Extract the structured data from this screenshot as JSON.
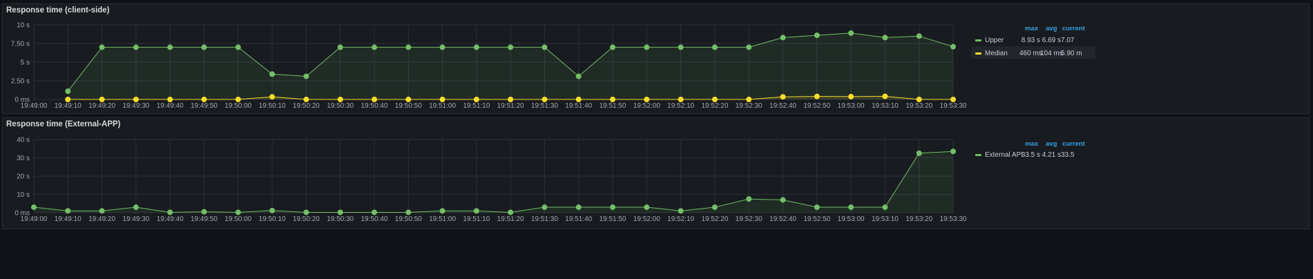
{
  "chart_data": [
    {
      "type": "line",
      "title": "Response time (client-side)",
      "x": [
        "19:49:10",
        "19:49:20",
        "19:49:30",
        "19:49:40",
        "19:49:50",
        "19:50:00",
        "19:50:10",
        "19:50:20",
        "19:50:30",
        "19:50:40",
        "19:50:50",
        "19:51:00",
        "19:51:10",
        "19:51:20",
        "19:51:30",
        "19:51:40",
        "19:51:50",
        "19:52:00",
        "19:52:10",
        "19:52:20",
        "19:52:30",
        "19:52:40",
        "19:52:50",
        "19:53:00",
        "19:53:10",
        "19:53:20",
        "19:53:30"
      ],
      "x_ticks": [
        "19:49:00",
        "19:49:10",
        "19:49:20",
        "19:49:30",
        "19:49:40",
        "19:49:50",
        "19:50:00",
        "19:50:10",
        "19:50:20",
        "19:50:30",
        "19:50:40",
        "19:50:50",
        "19:51:00",
        "19:51:10",
        "19:51:20",
        "19:51:30",
        "19:51:40",
        "19:51:50",
        "19:52:00",
        "19:52:10",
        "19:52:20",
        "19:52:30",
        "19:52:40",
        "19:52:50",
        "19:53:00",
        "19:53:10",
        "19:53:20",
        "19:53:30"
      ],
      "y_ticks": [
        "0 ms",
        "2.50 s",
        "5 s",
        "7.50 s",
        "10 s"
      ],
      "ylim": [
        0,
        10
      ],
      "y_unit": "s",
      "grid": true,
      "legend_position": "right",
      "legend_columns": [
        "max",
        "avg",
        "current"
      ],
      "series": [
        {
          "name": "Upper",
          "color": "#73bf69",
          "values": [
            1.1,
            7.0,
            7.0,
            7.0,
            7.0,
            7.0,
            3.4,
            3.1,
            7.0,
            7.0,
            7.0,
            7.0,
            7.0,
            7.0,
            7.0,
            3.1,
            7.0,
            7.0,
            7.0,
            7.0,
            7.0,
            8.3,
            8.6,
            8.9,
            8.3,
            8.5,
            7.07
          ],
          "stats": [
            "8.93 s",
            "6.69 s",
            "7.07"
          ]
        },
        {
          "name": "Median",
          "color": "#fade2a",
          "values": [
            0.0,
            0.0,
            0.0,
            0.0,
            0.0,
            0.0,
            0.35,
            0.0,
            0.0,
            0.0,
            0.0,
            0.0,
            0.0,
            0.0,
            0.0,
            0.0,
            0.0,
            0.0,
            0.0,
            0.0,
            0.0,
            0.35,
            0.4,
            0.38,
            0.42,
            0.0,
            0.0
          ],
          "stats": [
            "460 ms",
            "104 ms",
            "5.90 m"
          ]
        }
      ]
    },
    {
      "type": "line",
      "title": "Response time (External-APP)",
      "x": [
        "19:49:00",
        "19:49:10",
        "19:49:20",
        "19:49:30",
        "19:49:40",
        "19:49:50",
        "19:50:00",
        "19:50:10",
        "19:50:20",
        "19:50:30",
        "19:50:40",
        "19:50:50",
        "19:51:00",
        "19:51:10",
        "19:51:20",
        "19:51:30",
        "19:51:40",
        "19:51:50",
        "19:52:00",
        "19:52:10",
        "19:52:20",
        "19:52:30",
        "19:52:40",
        "19:52:50",
        "19:53:00",
        "19:53:10",
        "19:53:20",
        "19:53:30"
      ],
      "x_ticks": [
        "19:49:00",
        "19:49:10",
        "19:49:20",
        "19:49:30",
        "19:49:40",
        "19:49:50",
        "19:50:00",
        "19:50:10",
        "19:50:20",
        "19:50:30",
        "19:50:40",
        "19:50:50",
        "19:51:00",
        "19:51:10",
        "19:51:20",
        "19:51:30",
        "19:51:40",
        "19:51:50",
        "19:52:00",
        "19:52:10",
        "19:52:20",
        "19:52:30",
        "19:52:40",
        "19:52:50",
        "19:53:00",
        "19:53:10",
        "19:53:20",
        "19:53:30"
      ],
      "y_ticks": [
        "0 ms",
        "10 s",
        "20 s",
        "30 s",
        "40 s"
      ],
      "ylim": [
        0,
        40
      ],
      "y_unit": "s",
      "grid": true,
      "legend_position": "right",
      "legend_columns": [
        "max",
        "avg",
        "current"
      ],
      "series": [
        {
          "name": "External API",
          "color": "#73bf69",
          "values": [
            3.0,
            1.0,
            1.0,
            3.0,
            0.2,
            0.5,
            0.2,
            1.2,
            0.2,
            0.2,
            0.2,
            0.2,
            1.0,
            1.0,
            0.2,
            3.0,
            3.0,
            3.0,
            3.0,
            1.0,
            3.0,
            7.5,
            7.0,
            3.0,
            3.0,
            3.0,
            32.5,
            33.5
          ],
          "stats": [
            "33.5 s",
            "4.21 s",
            "33.5"
          ]
        }
      ]
    }
  ]
}
